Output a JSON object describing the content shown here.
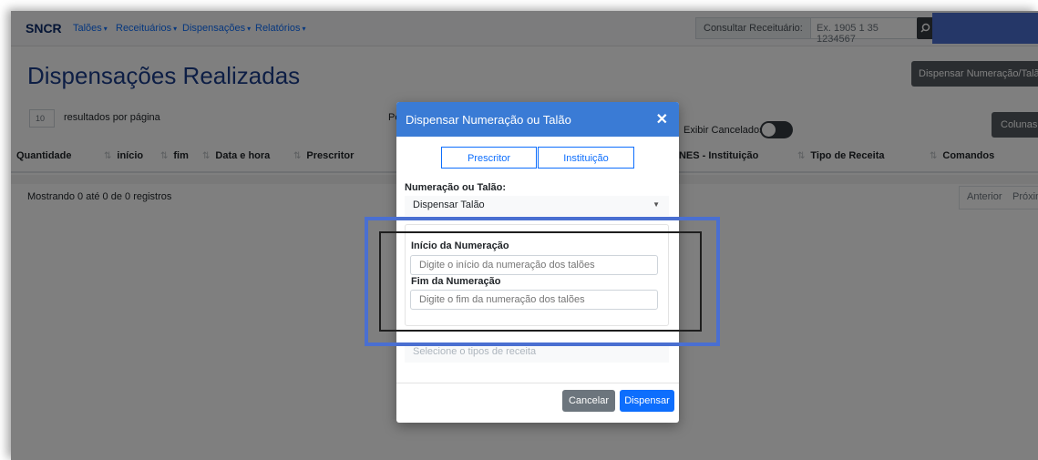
{
  "navbar": {
    "brand": "SNCR",
    "menu": [
      "Talões",
      "Receituários",
      "Dispensações",
      "Relatórios"
    ],
    "consult_label": "Consultar Receituário:",
    "consult_placeholder": "Ex. 1905 1 35 1234567"
  },
  "page": {
    "title": "Dispensações Realizadas",
    "dispense_button": "Dispensar Numeração/Talão",
    "per_page_value": "10",
    "per_page_label": "resultados por página",
    "search_label_partial": "Pe",
    "show_cancelled_label": "Exibir Cancelados:",
    "columns_button": "Colunas",
    "columns": [
      "Quantidade",
      "início",
      "fim",
      "Data e hora",
      "Prescritor",
      "CNES - Instituição",
      "Tipo de Receita",
      "Comandos"
    ],
    "info_text": "Mostrando 0 até 0 de 0 registros",
    "pagination": {
      "prev": "Anterior",
      "next": "Próximo"
    }
  },
  "modal": {
    "title": "Dispensar Numeração ou Talão",
    "segments": [
      "Prescritor",
      "Instituição"
    ],
    "type_label": "Numeração ou Talão:",
    "type_value": "Dispensar Talão",
    "start_label": "Início da Numeração",
    "start_placeholder": "Digite o início da numeração dos talões",
    "end_label": "Fim da Numeração",
    "end_placeholder": "Digite o fim da numeração dos talões",
    "recipe_placeholder": "Selecione o tipos de receita",
    "cancel_button": "Cancelar",
    "confirm_button": "Dispensar"
  },
  "colors": {
    "modal_header": "#3a7bd5",
    "primary": "#0d6efd",
    "highlight_border": "#4a6fd1",
    "title_blue": "#1b3c8a"
  }
}
